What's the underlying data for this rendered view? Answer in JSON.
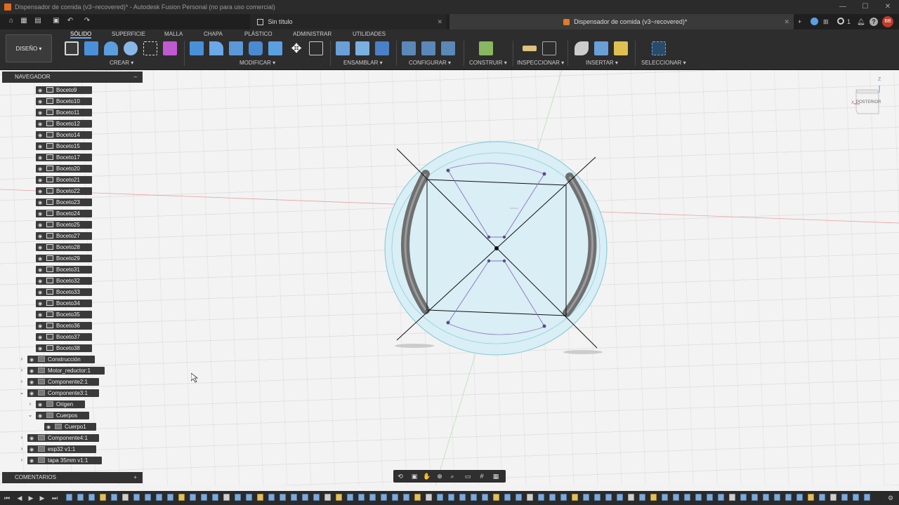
{
  "window": {
    "title": "Dispensador de comida (v3~recovered)* - Autodesk Fusion Personal (no para uso comercial)",
    "minimize": "—",
    "maximize": "☐",
    "close": "✕"
  },
  "tabs": [
    {
      "label": "Sin título",
      "close": "✕"
    },
    {
      "label": "Dispensador de comida (v3~recovered)*",
      "close": "✕"
    }
  ],
  "user": {
    "count": "1",
    "help": "?",
    "initials": "BB"
  },
  "ribbon": {
    "design": "DISEÑO ▾",
    "tabs": [
      "SÓLIDO",
      "SUPERFICIE",
      "MALLA",
      "CHAPA",
      "PLÁSTICO",
      "ADMINISTRAR",
      "UTILIDADES"
    ],
    "groups": [
      "CREAR ▾",
      "MODIFICAR ▾",
      "ENSAMBLAR ▾",
      "CONFIGURAR ▾",
      "CONSTRUIR ▾",
      "INSPECCIONAR ▾",
      "INSERTAR ▾",
      "SELECCIONAR ▾"
    ]
  },
  "browser": {
    "title": "NAVEGADOR",
    "collapse": "–",
    "sketches": [
      "Boceto9",
      "Boceto10",
      "Boceto11",
      "Boceto12",
      "Boceto14",
      "Boceto15",
      "Boceto17",
      "Boceto20",
      "Boceto21",
      "Boceto22",
      "Boceto23",
      "Boceto24",
      "Boceto25",
      "Boceto27",
      "Boceto28",
      "Boceto29",
      "Boceto31",
      "Boceto32",
      "Boceto33",
      "Boceto34",
      "Boceto35",
      "Boceto36",
      "Boceto37",
      "Boceto38"
    ],
    "components": [
      "Construcción",
      "Motor_reductor:1",
      "Componente2:1",
      "Componente3:1",
      "Origen",
      "Cuerpos",
      "Cuerpo1",
      "Componente4:1",
      "esp32 v1:1",
      "tapa 35mm v1:1"
    ]
  },
  "comments": {
    "title": "COMENTARIOS",
    "add": "+"
  },
  "viewcube": {
    "face": "POSTERIOR",
    "axis_z": "Z",
    "axis_x": "X"
  },
  "colors": {
    "accent": "#6aa8e8",
    "sketch": "#000000",
    "construction": "#8a6fc9",
    "body": "#6f6f6f",
    "profile": "#bfe0ee"
  }
}
